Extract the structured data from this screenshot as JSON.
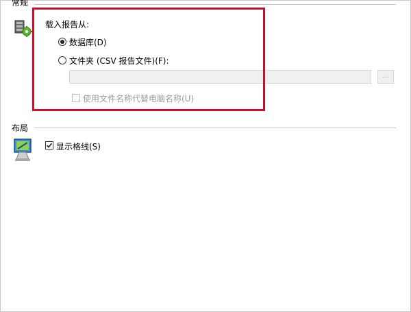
{
  "general": {
    "title": "常规",
    "load_report_from_label": "载入报告从:",
    "database_option_label": "数据库(D)",
    "folder_option_label": "文件夹 (CSV 报告文件)(F):",
    "folder_path_value": "",
    "browse_button_label": "...",
    "use_filename_checkbox_label": "使用文件名称代替电脑名称(U)",
    "icon": "server-icon"
  },
  "layout": {
    "title": "布局",
    "show_gridlines_label": "显示格线(S)",
    "show_gridlines_checked": true,
    "icon": "monitor-icon"
  },
  "selected_source": "database",
  "highlight_color": "#c8102e"
}
